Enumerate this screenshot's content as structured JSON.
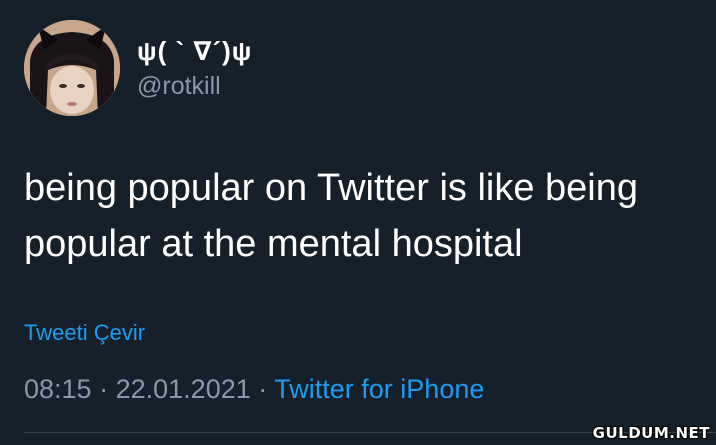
{
  "author": {
    "display_name": "ψ( ` ∇´)ψ",
    "handle": "@rotkill"
  },
  "tweet": {
    "text": "being popular on Twitter is like being popular at the mental hospital",
    "translate_label": "Tweeti Çevir",
    "time": "08:15",
    "separator": "·",
    "date": "22.01.2021",
    "source": "Twitter for iPhone"
  },
  "watermark": "GULDUM.NET",
  "colors": {
    "background": "#15202b",
    "text": "#ffffff",
    "muted": "#8899a6",
    "link": "#1d9bf0"
  }
}
